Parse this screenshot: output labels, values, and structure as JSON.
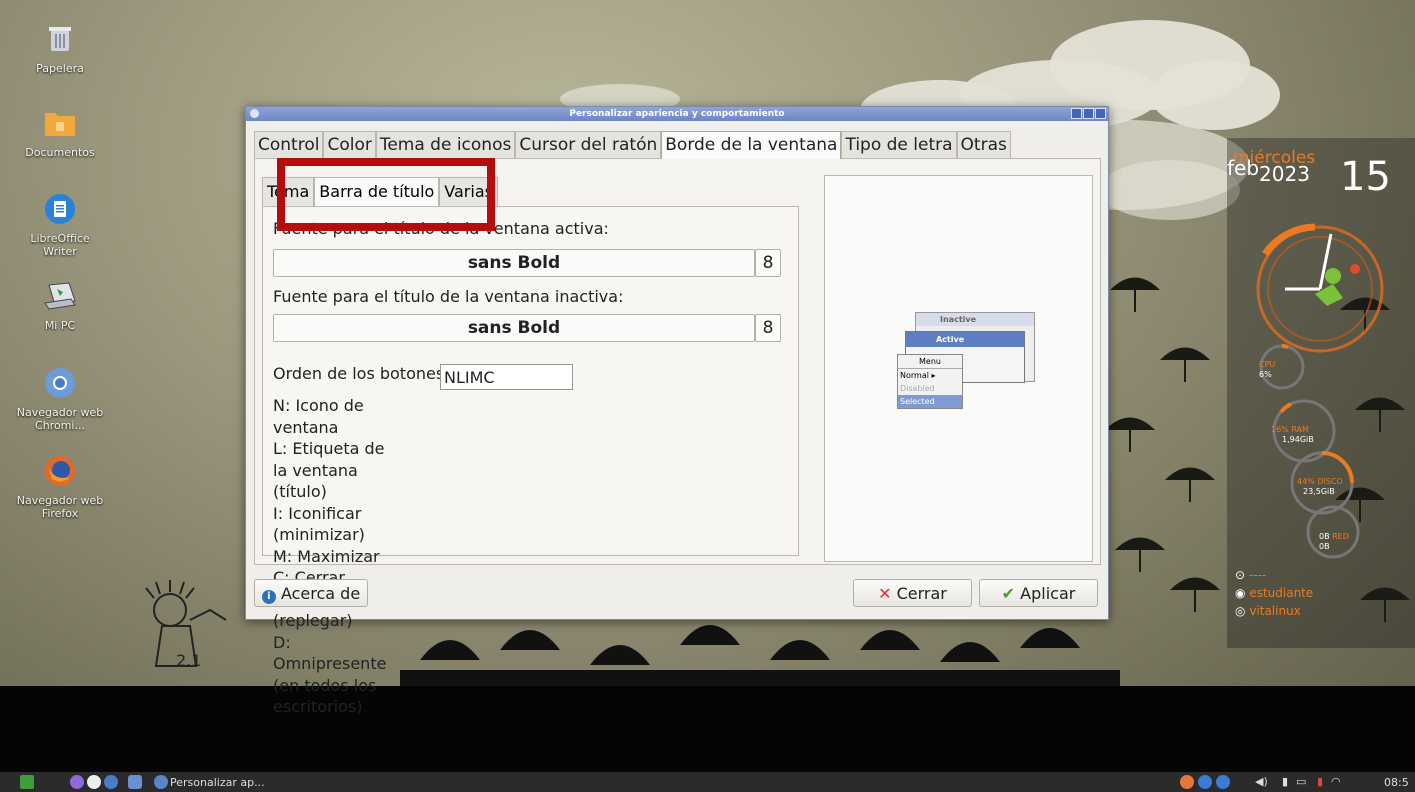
{
  "desktop": {
    "icons": [
      {
        "label": "Papelera",
        "icon": "trash-icon"
      },
      {
        "label": "Documentos",
        "icon": "folder-icon"
      },
      {
        "label": "LibreOffice Writer",
        "icon": "writer-icon"
      },
      {
        "label": "Mi PC",
        "icon": "computer-icon"
      },
      {
        "label": "Navegador web Chromi...",
        "icon": "chromium-icon"
      },
      {
        "label": "Navegador web Firefox",
        "icon": "firefox-icon"
      }
    ]
  },
  "window": {
    "title": "Personalizar apariencia y comportamiento",
    "tabs": [
      "Control",
      "Color",
      "Tema de iconos",
      "Cursor del ratón",
      "Borde de la ventana",
      "Tipo de letra",
      "Otras"
    ],
    "active_tab": "Borde de la ventana",
    "subtabs": [
      "Tema",
      "Barra de título",
      "Varias"
    ],
    "active_subtab": "Barra de título",
    "active_font_label": "Fuente para el título de la ventana activa:",
    "active_font_value": "sans Bold",
    "active_font_size": "8",
    "inactive_font_label": "Fuente para el título de la ventana inactiva:",
    "inactive_font_value": "sans Bold",
    "inactive_font_size": "8",
    "order_label": "Orden de los botones:",
    "order_value": "NLIMC",
    "legend": [
      "N: Icono de ventana",
      "L: Etiqueta de la ventana (título)",
      "I: Iconificar (minimizar)",
      "M: Maximizar",
      "C: Cerrar",
      "S: Sombra (replegar)",
      "D: Omnipresente (en todos los escritorios)"
    ],
    "preview": {
      "inactive": "Inactive",
      "active": "Active",
      "menu_title": "Menu",
      "menu_items": [
        "Normal",
        "Disabled",
        "Selected"
      ]
    },
    "about_label": "Acerca de",
    "close_label": "Cerrar",
    "apply_label": "Aplicar"
  },
  "widget": {
    "weekday": "miércoles",
    "month": "feb",
    "year": "2023",
    "day": "15",
    "cpu_label": "CPU",
    "cpu_value": "6%",
    "ram_label": "16% RAM",
    "ram_value": "1,94GiB",
    "disk_label": "44% DISCO",
    "disk_value": "23,5GiB",
    "net_up": "0B",
    "net_label": "RED",
    "net_down": "0B",
    "ip": "----",
    "user": "estudiante",
    "host": "vitalinux"
  },
  "taskbar": {
    "task_label": "Personalizar ap...",
    "clock": "08:5"
  }
}
